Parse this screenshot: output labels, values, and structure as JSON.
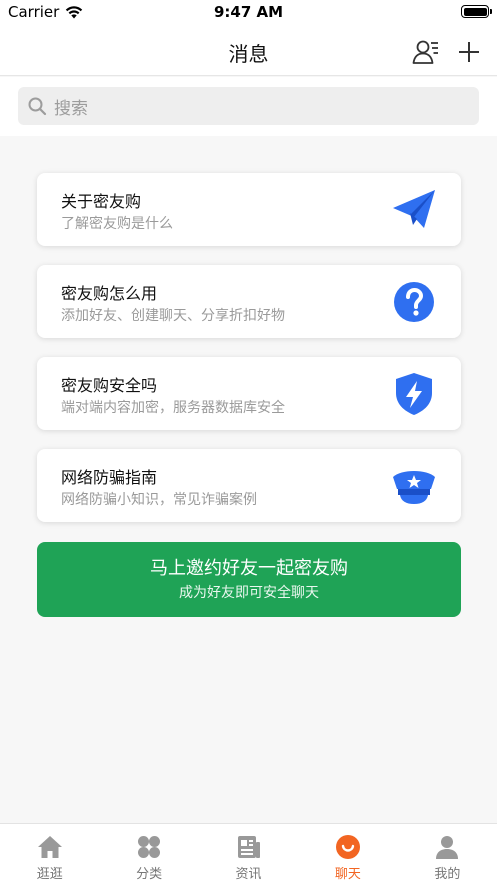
{
  "status_bar": {
    "carrier": "Carrier",
    "time": "9:47 AM"
  },
  "nav": {
    "title": "消息",
    "contacts_icon": "contacts-icon",
    "add_icon": "plus-icon"
  },
  "search": {
    "placeholder": "搜索",
    "icon": "search-icon"
  },
  "cards": [
    {
      "title": "关于密友购",
      "subtitle": "了解密友购是什么",
      "icon": "paper-plane-icon"
    },
    {
      "title": "密友购怎么用",
      "subtitle": "添加好友、创建聊天、分享折扣好物",
      "icon": "question-icon"
    },
    {
      "title": "密友购安全吗",
      "subtitle": "端对端内容加密，服务器数据库安全",
      "icon": "shield-icon"
    },
    {
      "title": "网络防骗指南",
      "subtitle": "网络防骗小知识，常见诈骗案例",
      "icon": "police-cap-icon"
    }
  ],
  "invite": {
    "title": "马上邀约好友一起密友购",
    "subtitle": "成为好友即可安全聊天"
  },
  "tabs": [
    {
      "label": "逛逛",
      "icon": "home-icon",
      "active": false
    },
    {
      "label": "分类",
      "icon": "category-icon",
      "active": false
    },
    {
      "label": "资讯",
      "icon": "news-icon",
      "active": false
    },
    {
      "label": "聊天",
      "icon": "chat-icon",
      "active": true
    },
    {
      "label": "我的",
      "icon": "profile-icon",
      "active": false
    }
  ],
  "colors": {
    "accent_green": "#1fa356",
    "active_tab": "#f26522",
    "icon_blue": "#2f6ff0",
    "inactive_tab": "#999999"
  }
}
